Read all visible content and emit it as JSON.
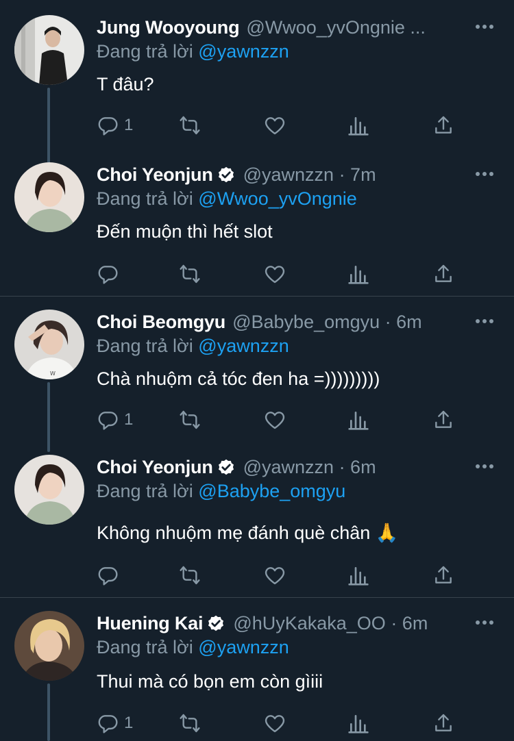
{
  "reply_prefix": "Đang trả lời",
  "tweets": [
    {
      "name": "Jung Wooyoung",
      "verified": false,
      "handle": "@Wwoo_yvOngnie ...",
      "time": "",
      "reply_to": "@yawnzzn",
      "text": "T đâu?",
      "reply_count": "1"
    },
    {
      "name": "Choi Yeonjun",
      "verified": true,
      "handle": "@yawnzzn · 7m",
      "reply_to": "@Wwoo_yvOngnie",
      "text": "Đến muộn thì hết slot",
      "reply_count": ""
    },
    {
      "name": "Choi Beomgyu",
      "verified": false,
      "handle": "@Babybe_omgyu · 6m",
      "reply_to": "@yawnzzn",
      "text": "Chà nhuộm cả tóc đen ha =)))))))))",
      "reply_count": "1"
    },
    {
      "name": "Choi Yeonjun",
      "verified": true,
      "handle": "@yawnzzn · 6m",
      "reply_to": "@Babybe_omgyu",
      "text": "Không nhuộm mẹ đánh què chân 🙏",
      "reply_count": ""
    },
    {
      "name": "Huening Kai",
      "verified": true,
      "handle": "@hUyKakaka_OO · 6m",
      "reply_to": "@yawnzzn",
      "text": "Thui mà có bọn em còn gìiii",
      "reply_count": "1"
    }
  ],
  "icons": {
    "reply": "reply-icon",
    "retweet": "retweet-icon",
    "like": "heart-icon",
    "analytics": "analytics-icon",
    "share": "share-icon",
    "verified": "verified-badge-icon",
    "more": "more-icon"
  },
  "colors": {
    "background": "#15202b",
    "secondary_text": "#8899a6",
    "link": "#1da1f2",
    "thread_line": "#3d5466",
    "divider": "#38444d"
  }
}
